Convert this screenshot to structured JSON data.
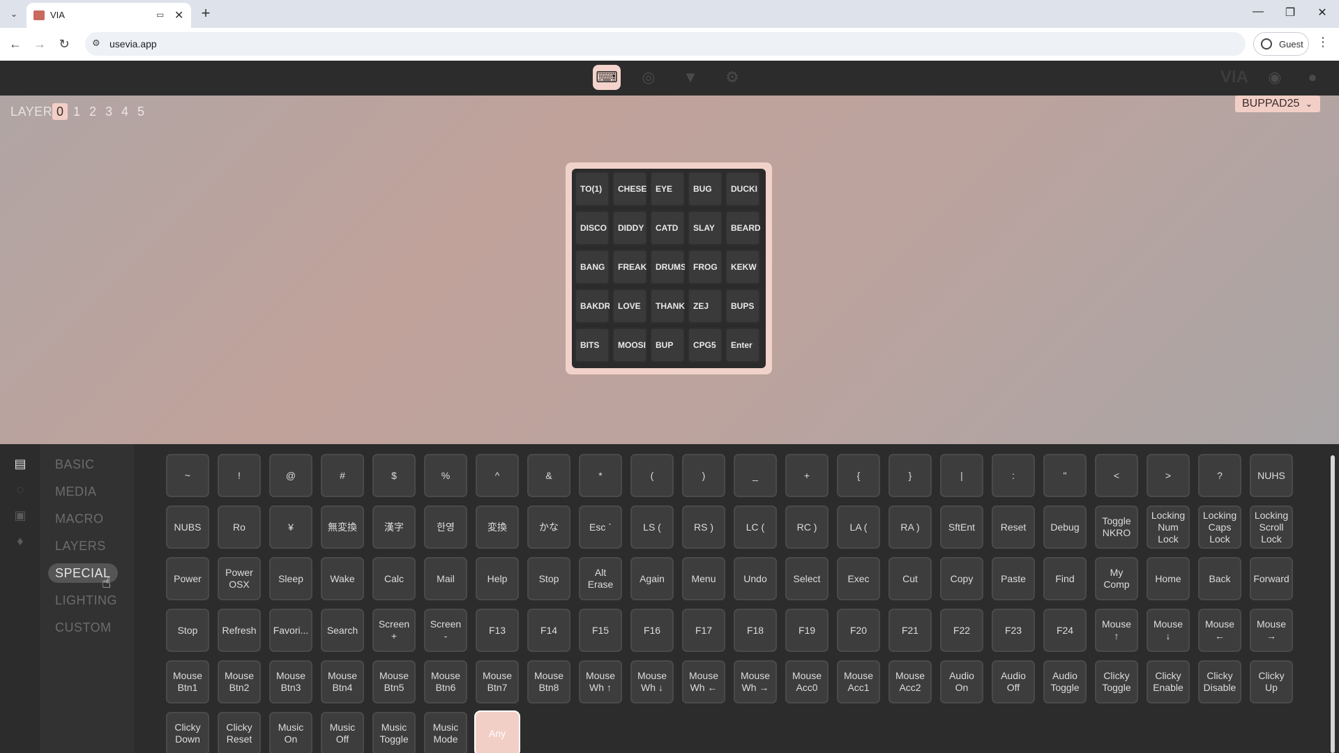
{
  "browser": {
    "tab_title": "VIA",
    "url": "usevia.app",
    "profile_label": "Guest"
  },
  "header": {
    "brand": "VIA",
    "modes": [
      "keyboard-icon",
      "gamepad-icon",
      "debug-icon",
      "settings-icon"
    ],
    "active_mode": "keyboard-icon"
  },
  "layer_bar": {
    "label": "LAYER",
    "layers": [
      "0",
      "1",
      "2",
      "3",
      "4",
      "5"
    ],
    "active_layer": "0",
    "keyboard_name": "BUPPAD25"
  },
  "keyboard": {
    "rows": [
      [
        "TO(1)",
        "CHESE",
        "EYE",
        "BUG",
        "DUCKI"
      ],
      [
        "DISCO",
        "DIDDY",
        "CATD",
        "SLAY",
        "BEARD"
      ],
      [
        "BANG",
        "FREAK",
        "DRUMS",
        "FROG",
        "KEKW"
      ],
      [
        "BAKDR",
        "LOVE",
        "THANK",
        "ZEJ",
        "BUPS"
      ],
      [
        "BITS",
        "MOOSI",
        "BUP",
        "CPG5",
        "Enter"
      ]
    ]
  },
  "sidebar": {
    "categories": [
      "BASIC",
      "MEDIA",
      "MACRO",
      "LAYERS",
      "SPECIAL",
      "LIGHTING",
      "CUSTOM"
    ],
    "active": "SPECIAL",
    "rail_icons": [
      "keyboard-map-icon",
      "lighting-icon",
      "save-icon",
      "bulb-icon"
    ]
  },
  "keycodes": {
    "rows": [
      [
        "~",
        "!",
        "@",
        "#",
        "$",
        "%",
        "^",
        "&",
        "*",
        "(",
        ")",
        "_",
        "+",
        "{",
        "}",
        "|",
        ":",
        "\"",
        "<",
        ">",
        "?",
        "NUHS"
      ],
      [
        "NUBS",
        "Ro",
        "¥",
        "無変換",
        "漢字",
        "한영",
        "変換",
        "かな",
        "Esc `",
        "LS (",
        "RS )",
        "LC (",
        "RC )",
        "LA (",
        "RA )",
        "SftEnt",
        "Reset",
        "Debug",
        "Toggle\nNKRO",
        "Locking\nNum\nLock",
        "Locking\nCaps\nLock",
        "Locking\nScroll\nLock"
      ],
      [
        "Power",
        "Power\nOSX",
        "Sleep",
        "Wake",
        "Calc",
        "Mail",
        "Help",
        "Stop",
        "Alt\nErase",
        "Again",
        "Menu",
        "Undo",
        "Select",
        "Exec",
        "Cut",
        "Copy",
        "Paste",
        "Find",
        "My\nComp",
        "Home",
        "Back",
        "Forward"
      ],
      [
        "Stop",
        "Refresh",
        "Favori...",
        "Search",
        "Screen\n+",
        "Screen\n-",
        "F13",
        "F14",
        "F15",
        "F16",
        "F17",
        "F18",
        "F19",
        "F20",
        "F21",
        "F22",
        "F23",
        "F24",
        "Mouse\n↑",
        "Mouse\n↓",
        "Mouse\n←",
        "Mouse\n→"
      ],
      [
        "Mouse\nBtn1",
        "Mouse\nBtn2",
        "Mouse\nBtn3",
        "Mouse\nBtn4",
        "Mouse\nBtn5",
        "Mouse\nBtn6",
        "Mouse\nBtn7",
        "Mouse\nBtn8",
        "Mouse\nWh ↑",
        "Mouse\nWh ↓",
        "Mouse\nWh ←",
        "Mouse\nWh →",
        "Mouse\nAcc0",
        "Mouse\nAcc1",
        "Mouse\nAcc2",
        "Audio\nOn",
        "Audio\nOff",
        "Audio\nToggle",
        "Clicky\nToggle",
        "Clicky\nEnable",
        "Clicky\nDisable",
        "Clicky\nUp"
      ],
      [
        "Clicky\nDown",
        "Clicky\nReset",
        "Music\nOn",
        "Music\nOff",
        "Music\nToggle",
        "Music\nMode",
        "Any"
      ]
    ],
    "highlighted": "Any"
  },
  "colors": {
    "accent": "#f2cfc6",
    "panel_bg": "#2c2c2c",
    "key_bg": "#3d3d3d"
  }
}
